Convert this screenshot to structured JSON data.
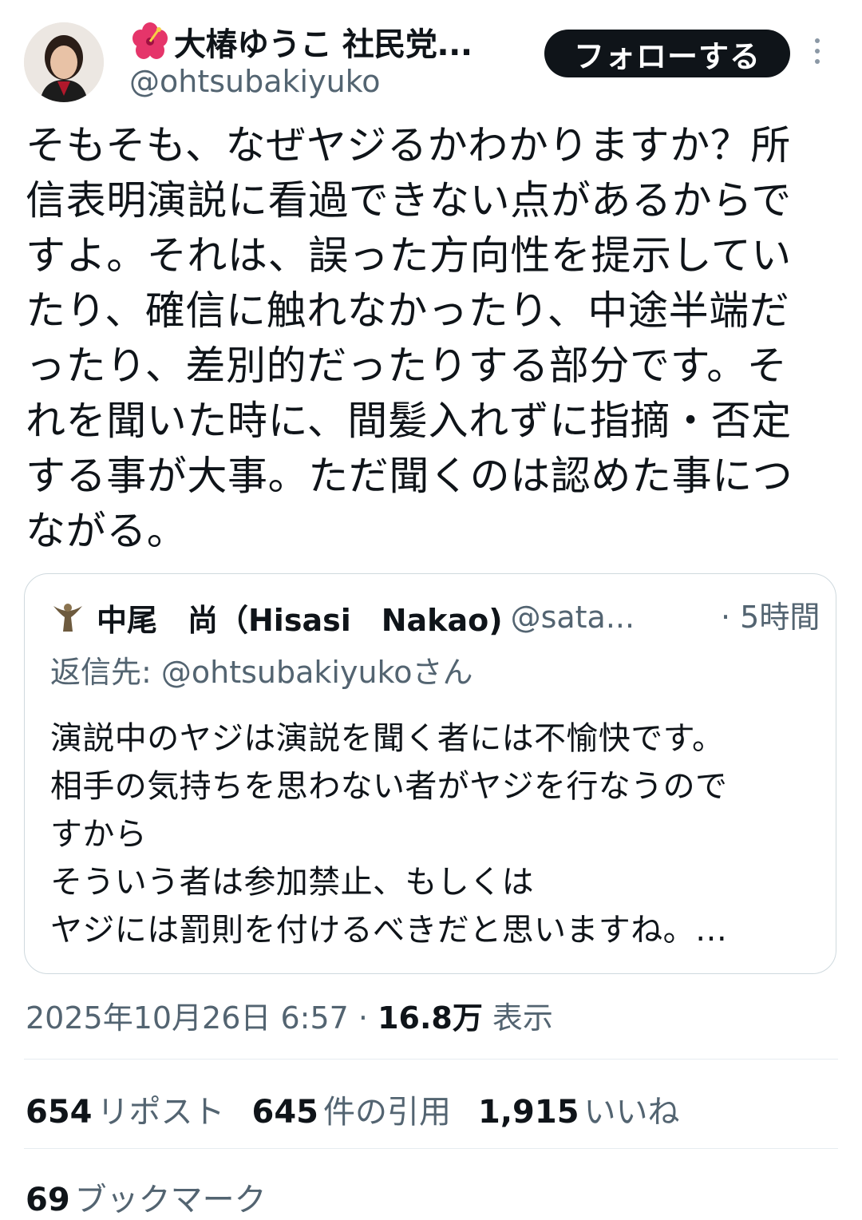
{
  "author": {
    "display_name": "大椿ゆうこ 社民党...",
    "handle": "@ohtsubakiyuko",
    "name_emoji_icon": "hibiscus-icon"
  },
  "follow_button_label": "フォローする",
  "tweet": {
    "lines": [
      "そもそも、なぜヤジるかわかりますか？所",
      "信表明演説に看過できない点があるからで",
      "すよ。それは、誤った方向性を提示してい",
      "たり、確信に触れなかったり、中途半端だ",
      "ったり、差別的だったりする部分です。そ",
      "れを聞いた時に、間髪入れずに指摘・否定",
      "する事が大事。ただ聞くのは認めた事につ",
      "ながる。"
    ]
  },
  "quote": {
    "name": "中尾　尚（Hisasi　Nakao)",
    "handle": "@sata...",
    "time": "· 5時間",
    "reply_to": "返信先: @ohtsubakiyukoさん",
    "lines": [
      "演説中のヤジは演説を聞く者には不愉快です。",
      "相手の気持ちを思わない者がヤジを行なうので",
      "すから",
      "そういう者は参加禁止、もしくは",
      "ヤジには罰則を付けるべきだと思いますね。…"
    ]
  },
  "meta": {
    "timestamp": "2025年10月26日 6:57 · ",
    "views_count": "16.8万",
    "views_label": " 表示"
  },
  "stats": {
    "reposts_count": "654",
    "reposts_label": "リポスト",
    "quotes_count": "645",
    "quotes_label": "件の引用",
    "likes_count": "1,915",
    "likes_label": "いいね"
  },
  "bookmarks": {
    "count": "69",
    "label": "ブックマーク"
  },
  "colors": {
    "text": "#0f1419",
    "secondary": "#536471",
    "border": "#cfd9de",
    "button": "#0f1419"
  }
}
